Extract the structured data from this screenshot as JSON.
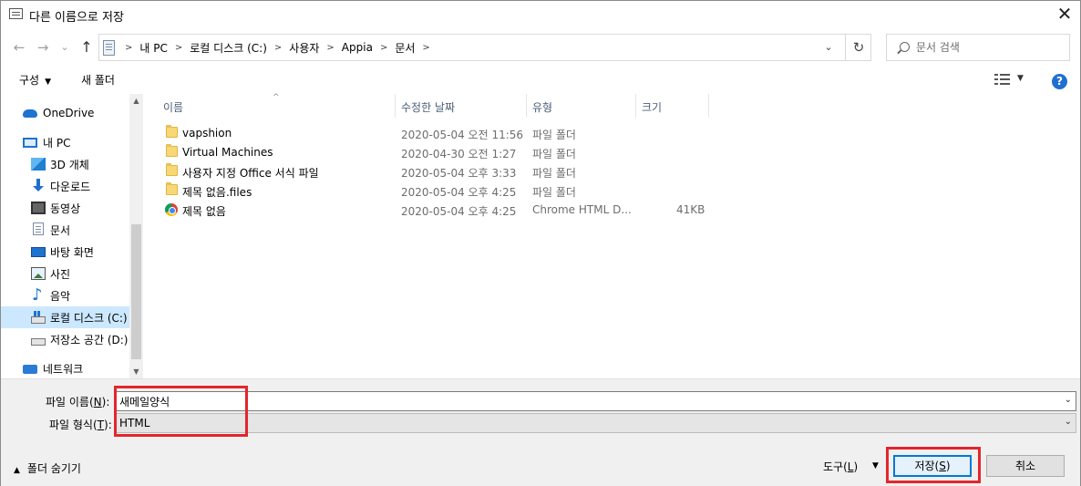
{
  "window": {
    "title": "다른 이름으로 저장",
    "close_label": "✕"
  },
  "nav": {
    "back": "←",
    "forward": "→",
    "dropdown": "⌄",
    "up": "↑"
  },
  "address": {
    "crumbs": [
      "내 PC",
      "로컬 디스크 (C:)",
      "사용자",
      "Appia",
      "문서"
    ],
    "separator": ">",
    "dropdown": "⌄",
    "refresh": "↻"
  },
  "search": {
    "placeholder": "문서 검색"
  },
  "toolbar": {
    "organize": "구성",
    "new_folder": "새 폴더",
    "help": "?"
  },
  "sidebar": {
    "items": [
      {
        "label": "OneDrive",
        "icon": "onedrive-cloud-icon"
      },
      {
        "label": "내 PC",
        "icon": "pc-icon"
      },
      {
        "label": "3D 개체",
        "icon": "3d-objects-icon"
      },
      {
        "label": "다운로드",
        "icon": "download-icon"
      },
      {
        "label": "동영상",
        "icon": "video-icon"
      },
      {
        "label": "문서",
        "icon": "document-icon"
      },
      {
        "label": "바탕 화면",
        "icon": "desktop-icon"
      },
      {
        "label": "사진",
        "icon": "picture-icon"
      },
      {
        "label": "음악",
        "icon": "music-icon"
      },
      {
        "label": "로컬 디스크 (C:)",
        "icon": "drive-icon"
      },
      {
        "label": "저장소 공간 (D:)",
        "icon": "drive-icon"
      },
      {
        "label": "네트워크",
        "icon": "network-icon"
      }
    ],
    "selected_index": 9
  },
  "filelist": {
    "columns": [
      "이름",
      "수정한 날짜",
      "유형",
      "크기"
    ],
    "rows": [
      {
        "name": "vapshion",
        "date": "2020-05-04 오전 11:56",
        "type": "파일 폴더",
        "size": "",
        "icon": "folder-icon"
      },
      {
        "name": "Virtual Machines",
        "date": "2020-04-30 오전 1:27",
        "type": "파일 폴더",
        "size": "",
        "icon": "folder-icon"
      },
      {
        "name": "사용자 지정 Office 서식 파일",
        "date": "2020-05-04 오후 3:33",
        "type": "파일 폴더",
        "size": "",
        "icon": "folder-icon"
      },
      {
        "name": "제목 없음.files",
        "date": "2020-05-04 오후 4:25",
        "type": "파일 폴더",
        "size": "",
        "icon": "folder-icon"
      },
      {
        "name": "제목 없음",
        "date": "2020-05-04 오후 4:25",
        "type": "Chrome HTML D...",
        "size": "41KB",
        "icon": "chrome-icon"
      }
    ]
  },
  "form": {
    "filename_label": "파일 이름(",
    "filename_key": "N",
    "filename_label_end": "):",
    "filename_value": "새메일양식",
    "filetype_label": "파일 형식(",
    "filetype_key": "T",
    "filetype_label_end": "):",
    "filetype_value": "HTML"
  },
  "footer": {
    "hide_folders": "폴더 숨기기",
    "tools": "도구(",
    "tools_key": "L",
    "tools_end": ")",
    "save": "저장(",
    "save_key": "S",
    "save_end": ")",
    "cancel": "취소"
  },
  "colors": {
    "accent": "#0078d7",
    "highlight": "#e3262c",
    "selection": "#cce8ff"
  }
}
